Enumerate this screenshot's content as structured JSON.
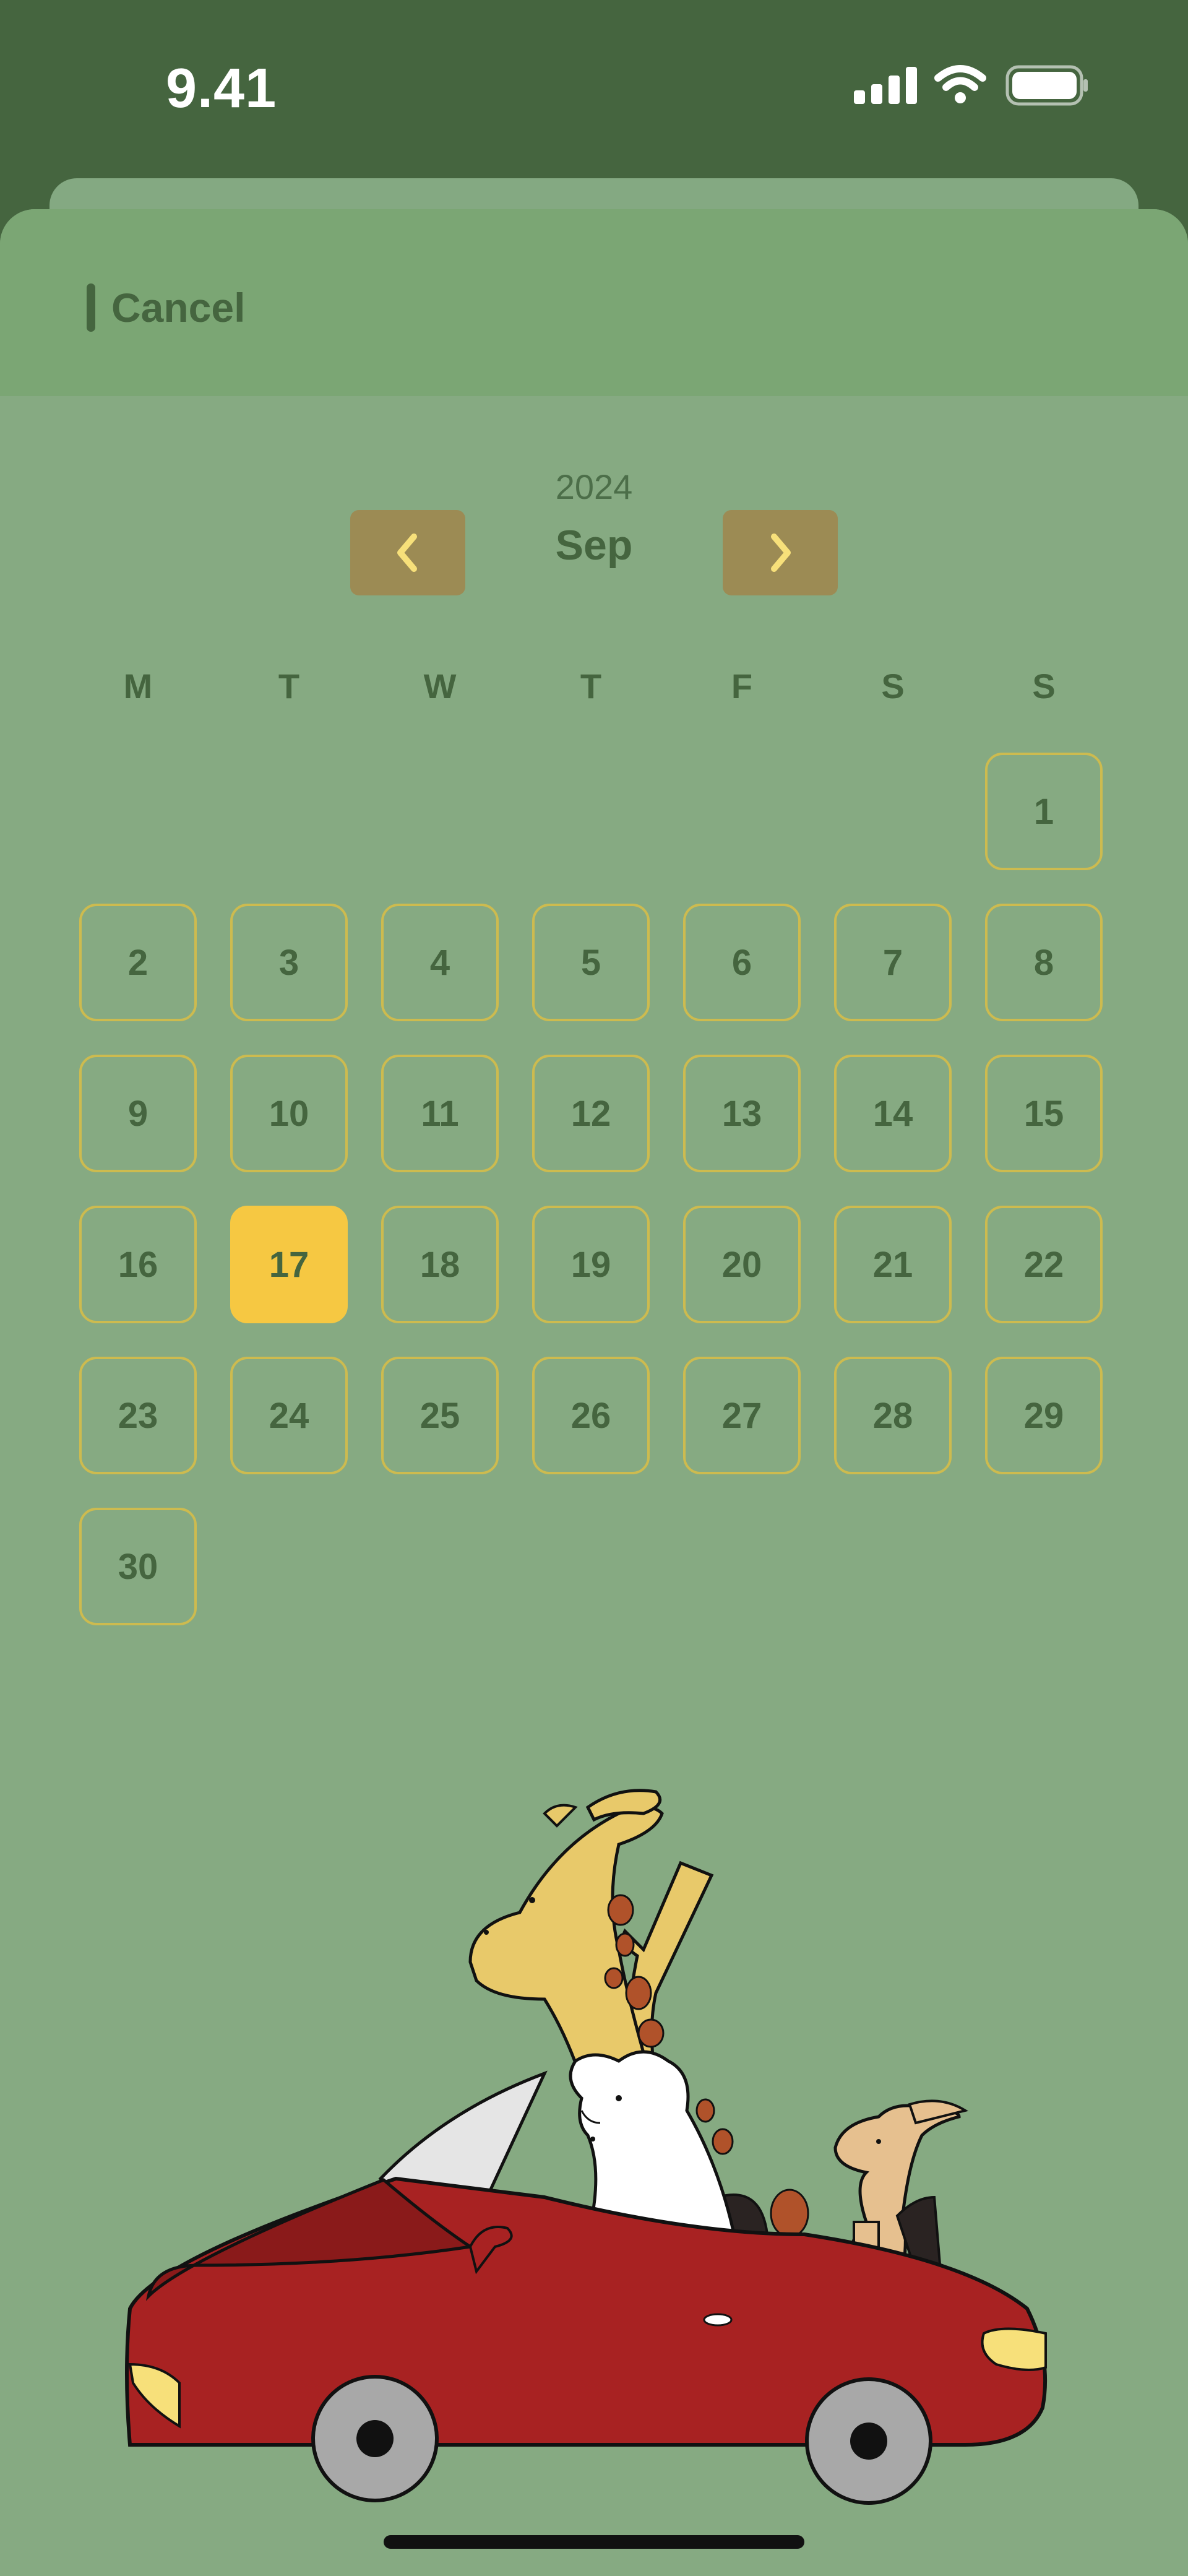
{
  "status_bar": {
    "time": "9.41",
    "signal_icon": "cellular-signal-icon",
    "wifi_icon": "wifi-icon",
    "battery_icon": "battery-icon"
  },
  "header": {
    "cancel_label": "Cancel"
  },
  "calendar": {
    "year": "2024",
    "month": "Sep",
    "prev_icon": "chevron-left-icon",
    "next_icon": "chevron-right-icon",
    "weekdays": [
      "M",
      "T",
      "W",
      "T",
      "F",
      "S",
      "S"
    ],
    "days": [
      "1",
      "2",
      "3",
      "4",
      "5",
      "6",
      "7",
      "8",
      "9",
      "10",
      "11",
      "12",
      "13",
      "14",
      "15",
      "16",
      "17",
      "18",
      "19",
      "20",
      "21",
      "22",
      "23",
      "24",
      "25",
      "26",
      "27",
      "28",
      "29",
      "30"
    ],
    "selected_day": "17",
    "colors": {
      "accent": "#f6c842",
      "text": "#45653f",
      "nav_button": "#9c8b54",
      "chevron": "#f7e07a",
      "cell_border": "#cdbb4f"
    }
  },
  "illustration": {
    "description_icon": "animals-in-red-convertible-illustration"
  }
}
